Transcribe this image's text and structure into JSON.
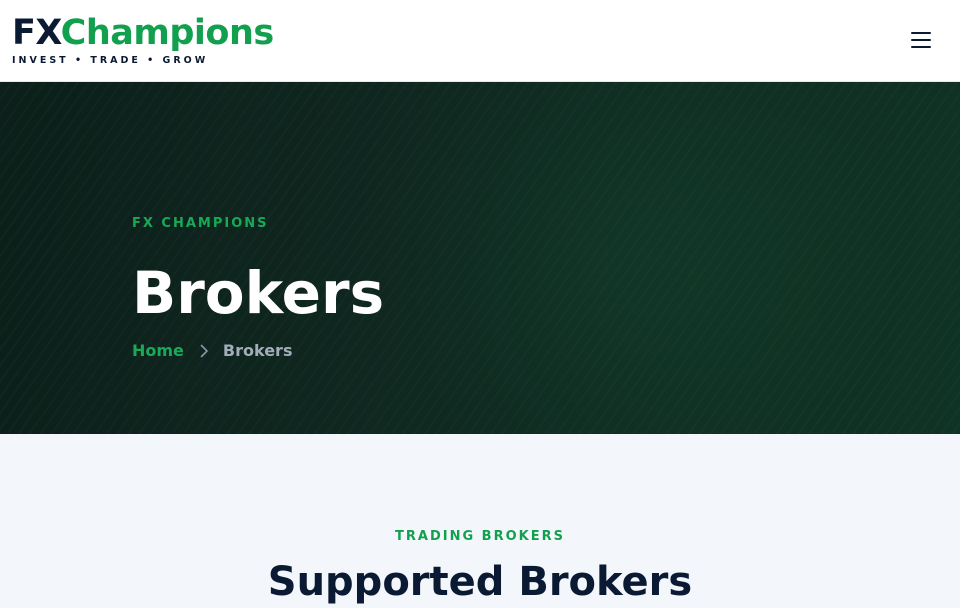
{
  "header": {
    "logo_fx": "FX",
    "logo_champions": "Champions",
    "tagline": "INVEST • TRADE • GROW",
    "menu_icon": "hamburger-menu-icon"
  },
  "hero": {
    "kicker": "FX CHAMPIONS",
    "title": "Brokers",
    "breadcrumb": {
      "home": "Home",
      "separator_icon": "chevron-right-icon",
      "current": "Brokers"
    }
  },
  "section": {
    "kicker": "TRADING BROKERS",
    "title": "Supported Brokers"
  },
  "colors": {
    "brand_green": "#12a04f",
    "navy": "#0b1a33",
    "hero_bg": "#0f2820",
    "section_bg": "#f3f7fb"
  }
}
